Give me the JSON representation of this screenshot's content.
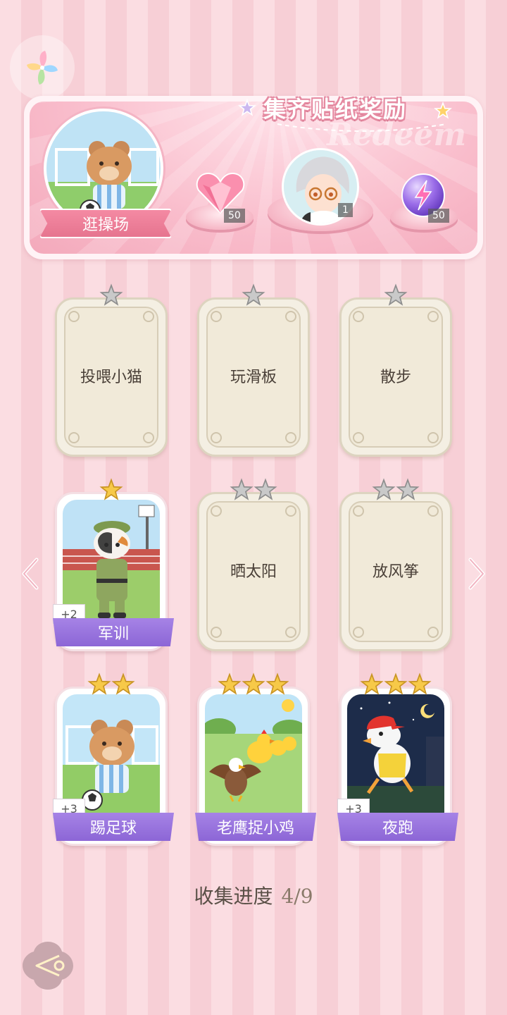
{
  "banner": {
    "title": "集齐贴纸奖励",
    "watermark": "Redeem",
    "location": "逛操场",
    "rewards": [
      {
        "name": "heart-gem",
        "count": "50"
      },
      {
        "name": "character-avatar",
        "count": "1"
      },
      {
        "name": "lightning-orb",
        "count": "50"
      }
    ]
  },
  "cards": [
    {
      "name": "投喂小猫",
      "stars": 1,
      "unlocked": false
    },
    {
      "name": "玩滑板",
      "stars": 1,
      "unlocked": false
    },
    {
      "name": "散步",
      "stars": 1,
      "unlocked": false
    },
    {
      "name": "军训",
      "stars": 1,
      "unlocked": true,
      "bonus": "+2"
    },
    {
      "name": "晒太阳",
      "stars": 2,
      "unlocked": false
    },
    {
      "name": "放风筝",
      "stars": 2,
      "unlocked": false
    },
    {
      "name": "踢足球",
      "stars": 2,
      "unlocked": true,
      "bonus": "+3"
    },
    {
      "name": "老鹰捉小鸡",
      "stars": 3,
      "unlocked": true,
      "bonus": ""
    },
    {
      "name": "夜跑",
      "stars": 3,
      "unlocked": true,
      "bonus": "+3"
    }
  ],
  "progress": {
    "label": "收集进度",
    "value": "4/9"
  },
  "colors": {
    "accent": "#f48aa3",
    "label_purple": "#9a75df",
    "gold_star": "#f7c948",
    "gray_star": "#b9b9b9"
  }
}
